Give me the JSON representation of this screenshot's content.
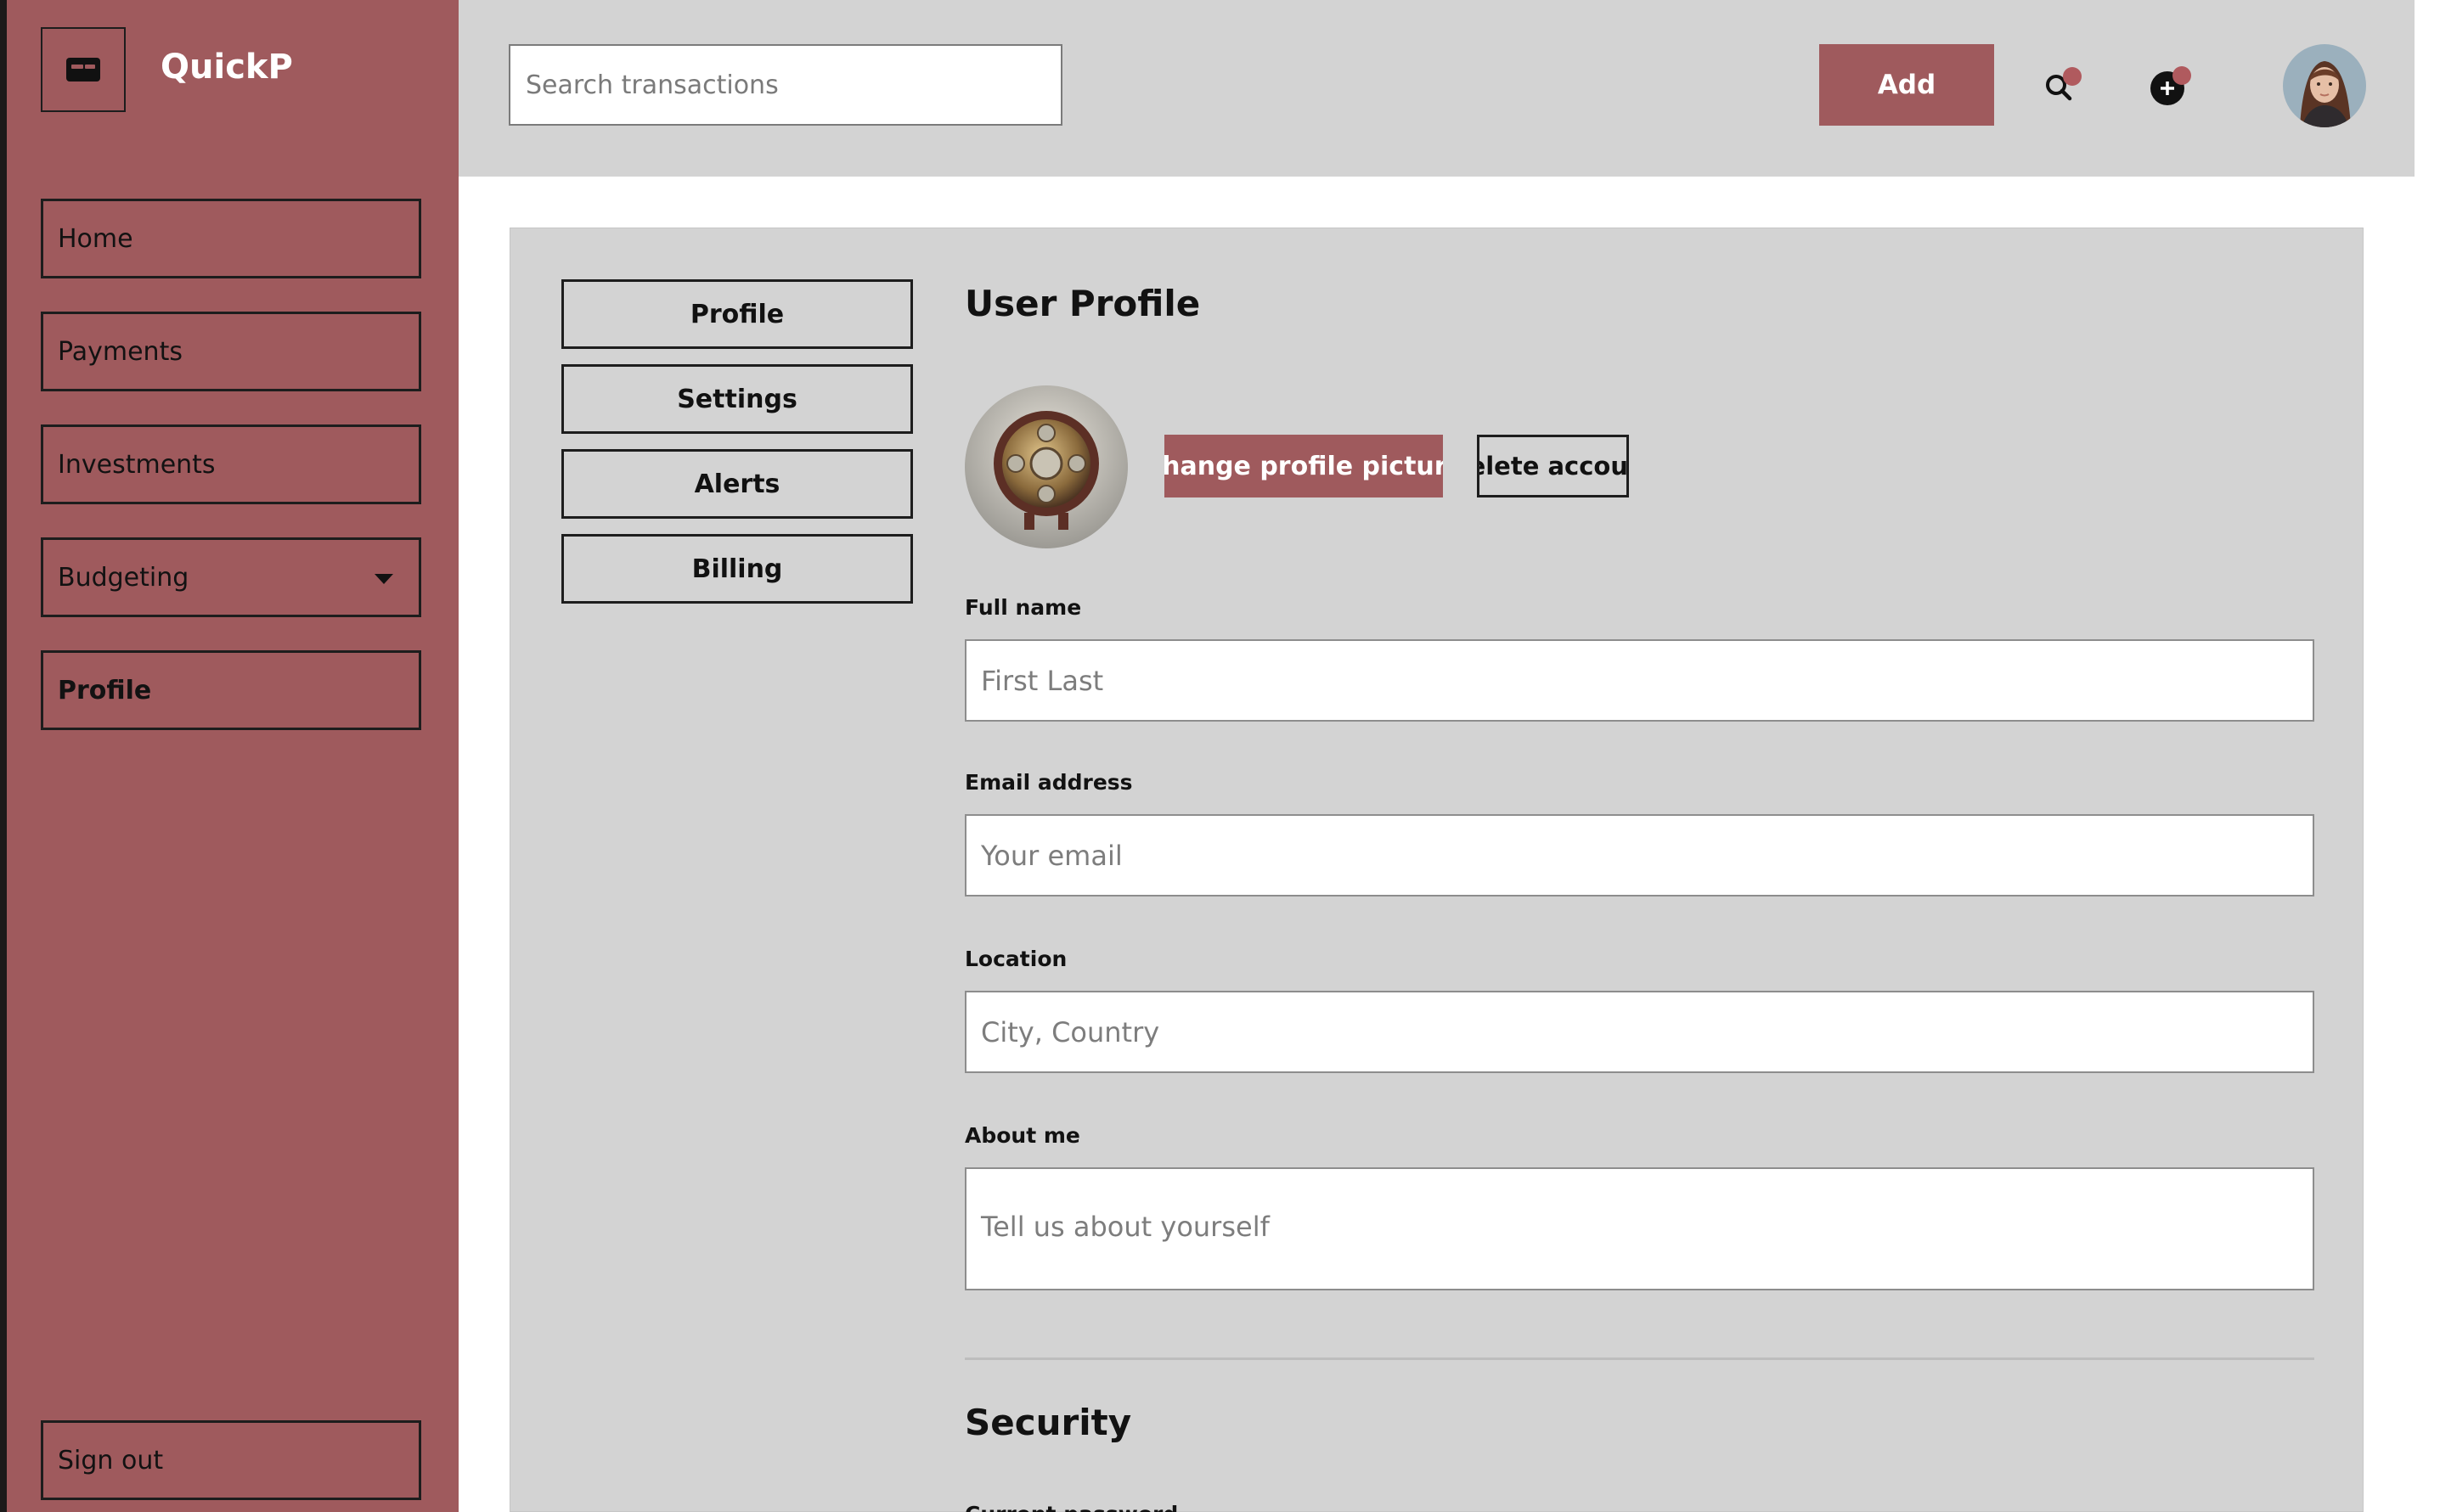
{
  "app": {
    "name": "QuickP"
  },
  "sidebar": {
    "items": [
      {
        "label": "Home"
      },
      {
        "label": "Payments"
      },
      {
        "label": "Investments"
      },
      {
        "label": "Budgeting"
      },
      {
        "label": "Profile"
      }
    ],
    "sign_out": "Sign out"
  },
  "header": {
    "search_placeholder": "Search transactions",
    "add_label": "Add",
    "icons": [
      "search-icon",
      "add-circle-icon",
      "user-avatar"
    ]
  },
  "tabs": [
    {
      "label": "Profile"
    },
    {
      "label": "Settings"
    },
    {
      "label": "Alerts"
    },
    {
      "label": "Billing"
    }
  ],
  "profile": {
    "title": "User Profile",
    "change_picture_label": "Change profile picture",
    "delete_account_label": "Delete account",
    "fields": {
      "full_name": {
        "label": "Full name",
        "placeholder": "First Last"
      },
      "email": {
        "label": "Email address",
        "placeholder": "Your email"
      },
      "location": {
        "label": "Location",
        "placeholder": "City, Country"
      },
      "about": {
        "label": "About me",
        "placeholder": "Tell us about yourself"
      }
    }
  },
  "security": {
    "title": "Security",
    "current_password_label": "Current password"
  },
  "colors": {
    "accent": "#9f5a5d",
    "panel": "#d3d3d3",
    "notification_dot": "#b05a5e"
  }
}
